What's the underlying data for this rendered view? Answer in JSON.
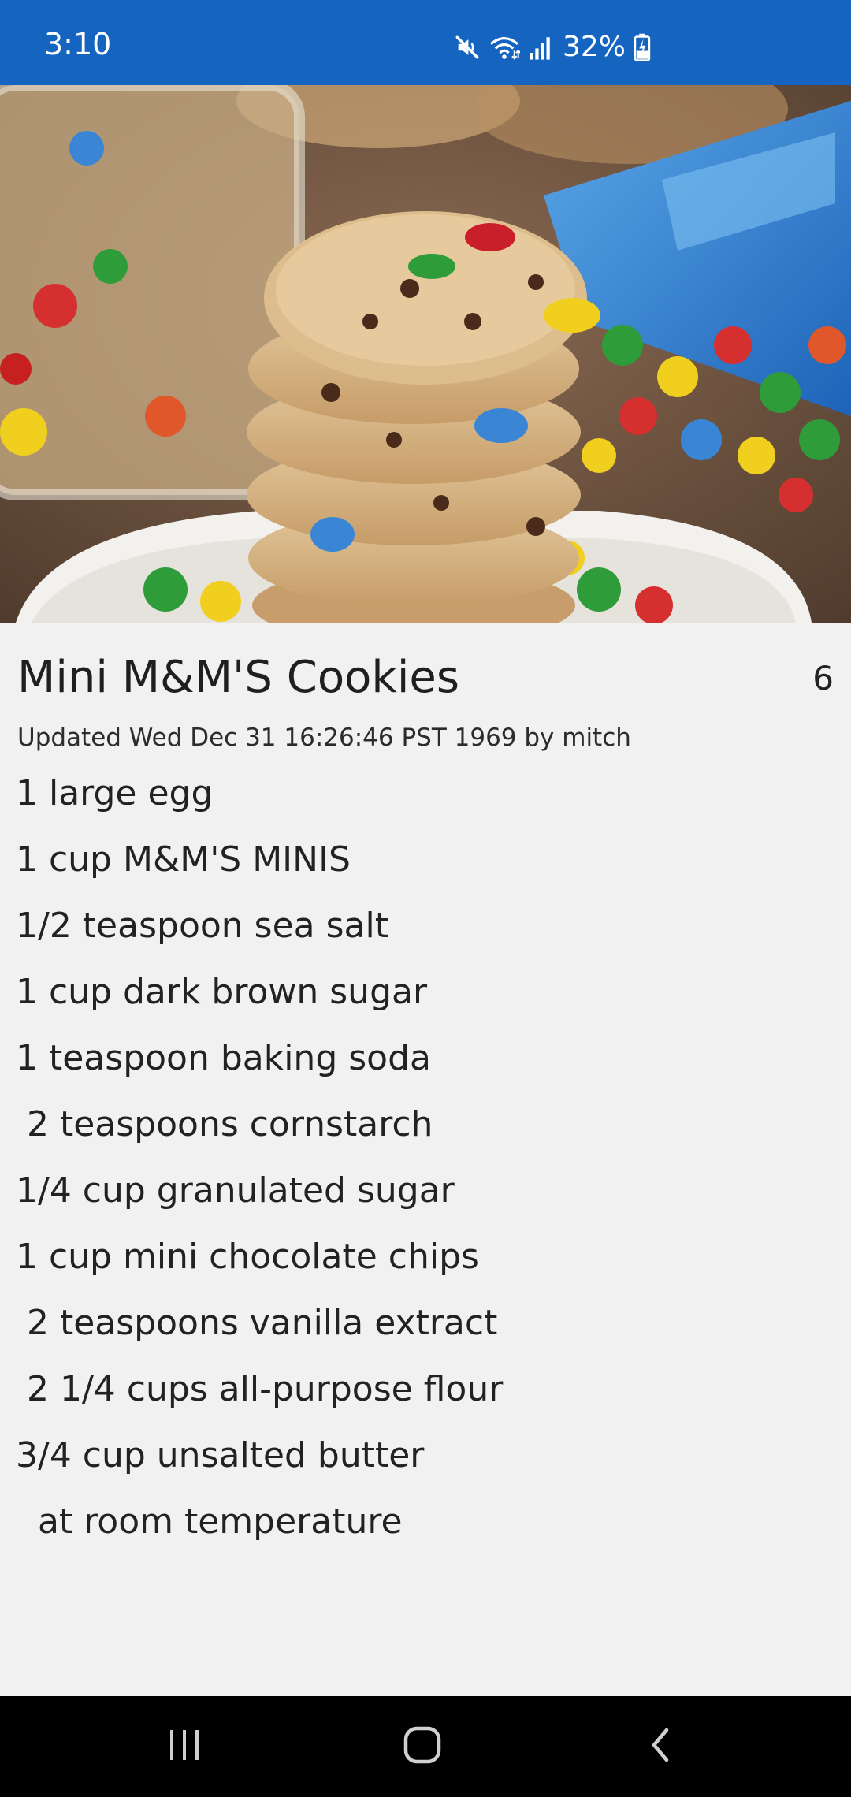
{
  "status_bar": {
    "time": "3:10",
    "battery": "32%",
    "icons": [
      "mute-icon",
      "wifi-icon",
      "signal-icon",
      "battery-charging-icon"
    ],
    "background_color": "#1565c0"
  },
  "hero_image": {
    "subject": "stack of M&M cookies with candies"
  },
  "recipe": {
    "title": "Mini M&M'S Cookies",
    "servings": "6",
    "updated": "Updated Wed Dec 31 16:26:46 PST 1969 by mitch",
    "ingredients": [
      "1 large egg",
      "1 cup M&M'S MINIS",
      "1/2 teaspoon sea salt",
      "1 cup dark brown sugar",
      "1 teaspoon baking soda",
      " 2 teaspoons cornstarch",
      "1/4 cup granulated sugar",
      "1 cup mini chocolate chips",
      " 2 teaspoons vanilla extract",
      " 2 1/4 cups all-purpose flour",
      "3/4 cup unsalted butter",
      "  at room temperature"
    ]
  },
  "nav_bar": {
    "buttons": [
      "recents-icon",
      "home-icon",
      "back-icon"
    ]
  }
}
